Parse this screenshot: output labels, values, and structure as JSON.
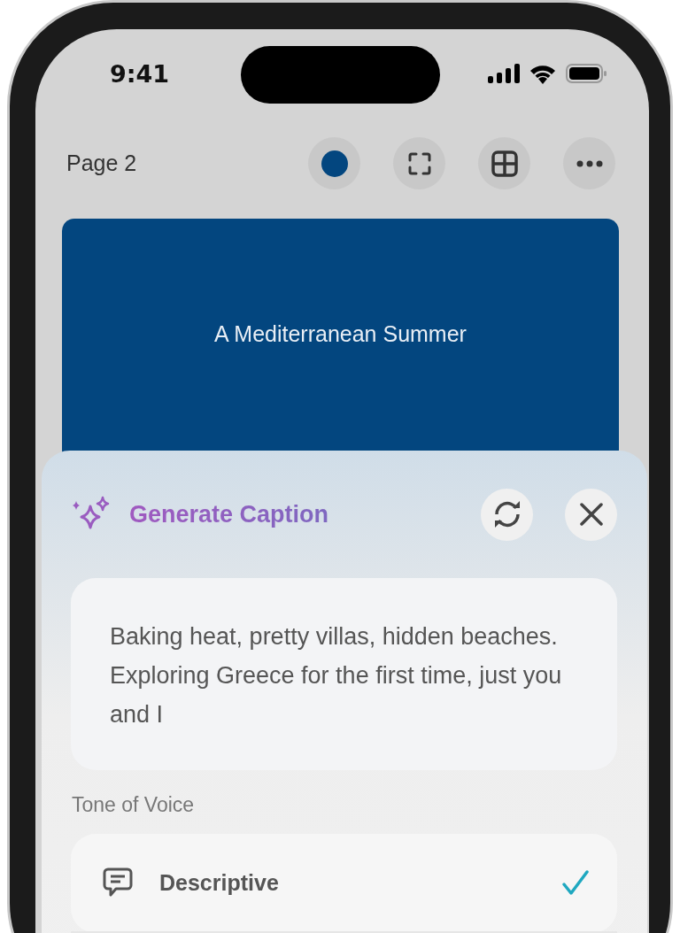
{
  "status_bar": {
    "time": "9:41"
  },
  "header": {
    "title": "Page 2"
  },
  "design_card": {
    "title": "A Mediterranean Summer"
  },
  "caption_panel": {
    "title": "Generate Caption",
    "caption": "Baking heat, pretty villas, hidden beaches. Exploring Greece for the first time, just you and I",
    "section_label": "Tone of Voice",
    "tones": [
      {
        "label": "Descriptive",
        "selected": true
      }
    ]
  }
}
